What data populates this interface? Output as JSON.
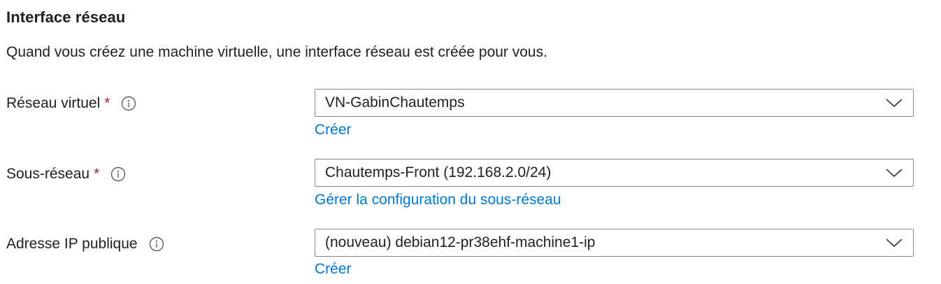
{
  "section": {
    "title": "Interface réseau",
    "description": "Quand vous créez une machine virtuelle, une interface réseau est créée pour vous."
  },
  "fields": [
    {
      "label": "Réseau virtuel",
      "required": "*",
      "info_icon": "info-icon",
      "value": "VN-GabinChautemps",
      "link": "Créer"
    },
    {
      "label": "Sous-réseau",
      "required": "*",
      "info_icon": "info-icon",
      "value": "Chautemps-Front (192.168.2.0/24)",
      "link": "Gérer la configuration du sous-réseau"
    },
    {
      "label": "Adresse IP publique",
      "info_icon": "info-icon",
      "value": "(nouveau) debian12-pr38ehf-machine1-ip",
      "link": "Créer"
    }
  ],
  "colors": {
    "link": "#0078d4",
    "required": "#a4262c",
    "border": "#8a8886",
    "text": "#201f1e"
  }
}
